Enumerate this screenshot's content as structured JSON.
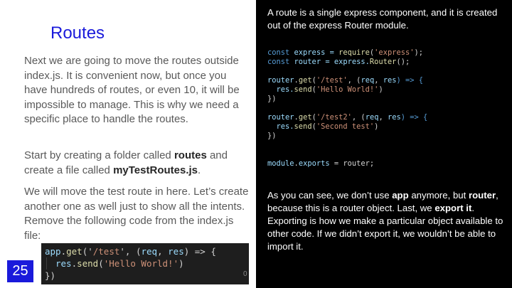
{
  "left": {
    "title": "Routes",
    "para1": "Next we are going to move the routes outside index.js. It is convenient now, but once you have hundreds of routes, or even 10, it will be impossible to manage. This is why we need a specific place to handle the routes.",
    "para2_a": "Start by creating a folder called ",
    "para2_b": "routes",
    "para2_c": " and create a file called ",
    "para2_d": "myTestRoutes.js",
    "para2_e": ".",
    "para3": "We will move the test route in here. Let’s create another one as well just to show all the intents. Remove the following code from the index.js file:",
    "snippet": {
      "l1_a": "app",
      "l1_b": ".",
      "l1_c": "get",
      "l1_d": "('",
      "l1_e": "/test",
      "l1_f": "', (",
      "l1_g": "req",
      "l1_h": ", ",
      "l1_i": "res",
      "l1_j": ") => {",
      "l2_a": "res",
      "l2_b": ".",
      "l2_c": "send",
      "l2_d": "(",
      "l2_e": "'Hello World!'",
      "l2_f": ")",
      "l3": "})"
    },
    "page_number": "25",
    "stub": "0"
  },
  "right": {
    "intro": "A route is a single express component, and it is created out of the express Router module.",
    "code": {
      "l1": [
        "const",
        " express = ",
        "require",
        "(",
        "'express'",
        ");"
      ],
      "l2": [
        "const",
        " router = express.",
        "Router",
        "();"
      ],
      "l3": [
        "router",
        ".",
        "get",
        "(",
        "'/test'",
        ", (",
        "req",
        ", ",
        "res",
        ") => {"
      ],
      "l4": [
        "  res.",
        "send",
        "(",
        "'Hello World!'",
        ")"
      ],
      "l5": "})",
      "l6": [
        "router",
        ".",
        "get",
        "(",
        "'/test2'",
        ", (",
        "req",
        ", ",
        "res",
        ") => {"
      ],
      "l7": [
        "  res.",
        "send",
        "(",
        "'Second test'",
        ")"
      ],
      "l8": "})",
      "l9": [
        "module",
        ".",
        "exports",
        " = router;"
      ]
    },
    "outro_a": "As you can see, we don’t use ",
    "outro_b": "app",
    "outro_c": " anymore, but ",
    "outro_d": "router",
    "outro_e": ", because this is a router object. Last, we ",
    "outro_f": "export it",
    "outro_g": ". Exporting is how we make a particular object available to other code. If we didn’t export it, we wouldn’t be able to import it."
  },
  "colors": {
    "title": "#1a1adb",
    "body_text": "#595959",
    "page_badge": "#1a1adb",
    "right_bg": "#000000"
  }
}
